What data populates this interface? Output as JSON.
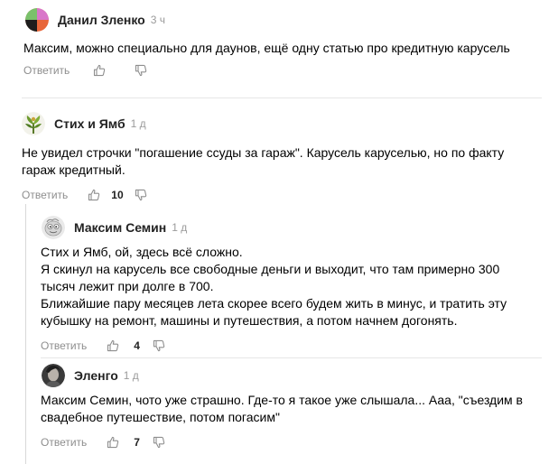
{
  "comments": [
    {
      "author": "Данил Зленко",
      "time": "3 ч",
      "lines": [
        "Максим, можно специально для даунов, ещё одну статью про кредитную карусель"
      ],
      "reply_label": "Ответить",
      "likes": "",
      "avatar": "colorful-circle-avatar"
    },
    {
      "author": "Стих и Ямб",
      "time": "1 д",
      "lines": [
        "Не увидел строчки \"погашение ссуды за гараж\". Карусель каруселью, но по факту",
        "гараж кредитный."
      ],
      "reply_label": "Ответить",
      "likes": "10",
      "avatar": "green-plant-avatar"
    },
    {
      "author": "Максим Семин",
      "time": "1 д",
      "lines": [
        "Стих и Ямб, ой, здесь всё сложно.",
        "Я скинул на карусель все свободные деньги и выходит, что там примерно 300",
        "тысяч лежит при долге в 700.",
        "Ближайшие пару месяцев лета скорее всего будем жить в минус, и тратить эту",
        "кубышку на ремонт, машины и путешествия, а потом начнем догонять."
      ],
      "reply_label": "Ответить",
      "likes": "4",
      "avatar": "cartoon-face-avatar"
    },
    {
      "author": "Эленго",
      "time": "1 д",
      "lines": [
        "Максим Семин, чото уже страшно. Где-то я такое уже слышала... Ааа, \"съездим в",
        "свадебное путешествие, потом погасим\""
      ],
      "reply_label": "Ответить",
      "likes": "7",
      "avatar": "photo-avatar"
    }
  ]
}
